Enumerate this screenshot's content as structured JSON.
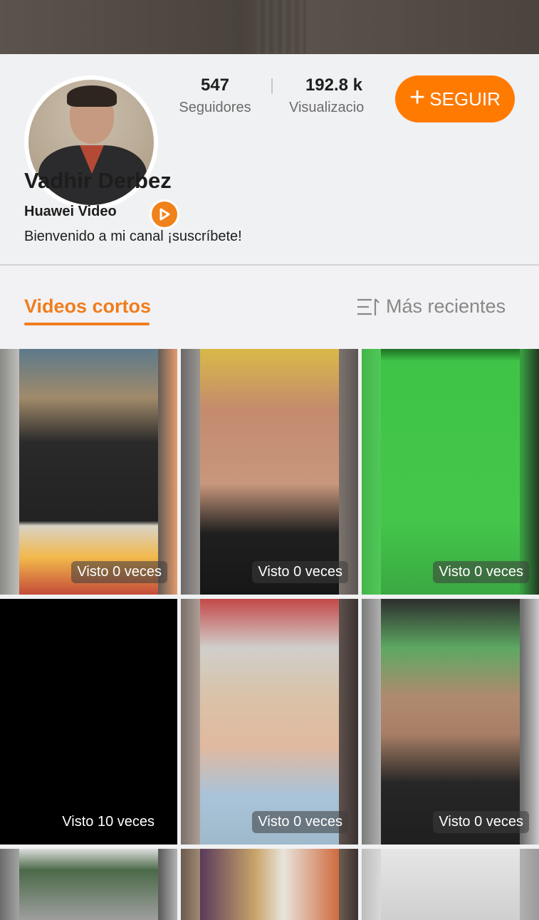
{
  "profile": {
    "name": "Vadhir Derbez",
    "platform": "Huawei Video",
    "description": "Bienvenido a mi canal ¡suscríbete!",
    "followers_count": "547",
    "followers_label": "Seguidores",
    "views_count": "192.8 k",
    "views_label": "Visualizacio",
    "follow_label": "SEGUIR"
  },
  "tabs": {
    "active_label": "Videos cortos",
    "sort_label": "Más recientes"
  },
  "videos": [
    {
      "views": "Visto 0 veces"
    },
    {
      "views": "Visto 0 veces"
    },
    {
      "views": "Visto 0 veces"
    },
    {
      "views": "Visto 10 veces"
    },
    {
      "views": "Visto 0 veces"
    },
    {
      "views": "Visto 0 veces"
    }
  ],
  "colors": {
    "accent": "#ff7a00",
    "background": "#f0f1f3"
  }
}
